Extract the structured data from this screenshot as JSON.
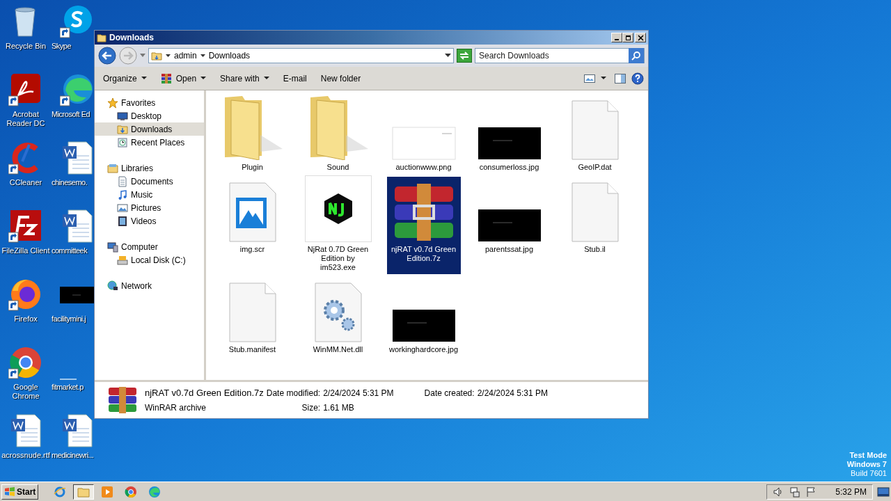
{
  "desktop": {
    "column_1": [
      {
        "label": "Recycle Bin",
        "kind": "recycle",
        "shortcut": false
      },
      {
        "label": "Acrobat Reader DC",
        "kind": "acrobat",
        "shortcut": true
      },
      {
        "label": "CCleaner",
        "kind": "ccleaner",
        "shortcut": true
      },
      {
        "label": "FileZilla Client",
        "kind": "filezilla",
        "shortcut": true
      },
      {
        "label": "Firefox",
        "kind": "firefox",
        "shortcut": true
      },
      {
        "label": "Google Chrome",
        "kind": "chrome",
        "shortcut": true
      },
      {
        "label": "acrossnude.rtf",
        "kind": "word",
        "shortcut": false
      }
    ],
    "column_2": [
      {
        "label": "Skype",
        "kind": "skype",
        "shortcut": true
      },
      {
        "label": "Microsoft Ed",
        "kind": "edge",
        "shortcut": true
      },
      {
        "label": "chinesemo.",
        "kind": "word",
        "shortcut": false
      },
      {
        "label": "committeek",
        "kind": "word",
        "shortcut": false
      },
      {
        "label": "facilitymini.j",
        "kind": "dark-thumb",
        "shortcut": false
      },
      {
        "label": "fitmarket.p",
        "kind": "light-thumb",
        "shortcut": false
      },
      {
        "label": "medicinewri...",
        "kind": "word",
        "shortcut": false
      }
    ],
    "watermark_lines": [
      "Test Mode",
      "Windows 7",
      "Build 7601"
    ]
  },
  "window": {
    "title": "Downloads",
    "breadcrumb": [
      "admin",
      "Downloads"
    ],
    "search": {
      "placeholder": "Search Downloads"
    },
    "toolbar": [
      {
        "label": "Organize",
        "dropdown": true
      },
      {
        "label": "Open",
        "dropdown": true
      },
      {
        "label": "Share with",
        "dropdown": true
      },
      {
        "label": "E-mail",
        "dropdown": false
      },
      {
        "label": "New folder",
        "dropdown": false
      }
    ],
    "sidebar": {
      "groups": [
        {
          "label": "Favorites",
          "children": [
            {
              "label": "Desktop",
              "selected": false
            },
            {
              "label": "Downloads",
              "selected": true
            },
            {
              "label": "Recent Places",
              "selected": false
            }
          ]
        },
        {
          "label": "Libraries",
          "children": [
            {
              "label": "Documents",
              "selected": false
            },
            {
              "label": "Music",
              "selected": false
            },
            {
              "label": "Pictures",
              "selected": false
            },
            {
              "label": "Videos",
              "selected": false
            }
          ]
        },
        {
          "label": "Computer",
          "children": [
            {
              "label": "Local Disk (C:)",
              "selected": false
            }
          ]
        },
        {
          "label": "Network"
        }
      ]
    },
    "files": [
      {
        "label": "Plugin",
        "kind": "folder",
        "selected": false
      },
      {
        "label": "Sound",
        "kind": "folder",
        "selected": false
      },
      {
        "label": "auctionwww.png",
        "kind": "light-thumb",
        "selected": false
      },
      {
        "label": "consumerloss.jpg",
        "kind": "dark-thumb",
        "selected": false
      },
      {
        "label": "GeoIP.dat",
        "kind": "blank-doc",
        "selected": false
      },
      {
        "label": "img.scr",
        "kind": "picture-doc",
        "selected": false
      },
      {
        "label": "NjRat 0.7D Green Edition by im523.exe",
        "kind": "hex-app",
        "selected": false
      },
      {
        "label": "njRAT v0.7d Green Edition.7z",
        "kind": "archive",
        "selected": true
      },
      {
        "label": "parentssat.jpg",
        "kind": "dark-thumb",
        "selected": false
      },
      {
        "label": "Stub.il",
        "kind": "blank-doc",
        "selected": false
      },
      {
        "label": "Stub.manifest",
        "kind": "blank-doc",
        "selected": false
      },
      {
        "label": "WinMM.Net.dll",
        "kind": "gear-doc",
        "selected": false
      },
      {
        "label": "workinghardcore.jpg",
        "kind": "dark-thumb",
        "selected": false
      }
    ],
    "details": {
      "name": "njRAT v0.7d Green Edition.7z",
      "type": "WinRAR archive",
      "fields": [
        {
          "label": "Date modified:",
          "value": "2/24/2024 5:31 PM"
        },
        {
          "label": "Size:",
          "value": "1.61 MB"
        },
        {
          "label": "Date created:",
          "value": "2/24/2024 5:31 PM"
        }
      ]
    }
  },
  "taskbar": {
    "start": "Start",
    "apps": [
      {
        "kind": "ie",
        "selected": false
      },
      {
        "kind": "explorer",
        "selected": true
      },
      {
        "kind": "media",
        "selected": false
      },
      {
        "kind": "chrome",
        "selected": false
      },
      {
        "kind": "edge",
        "selected": false
      }
    ],
    "clock": "5:32 PM"
  }
}
